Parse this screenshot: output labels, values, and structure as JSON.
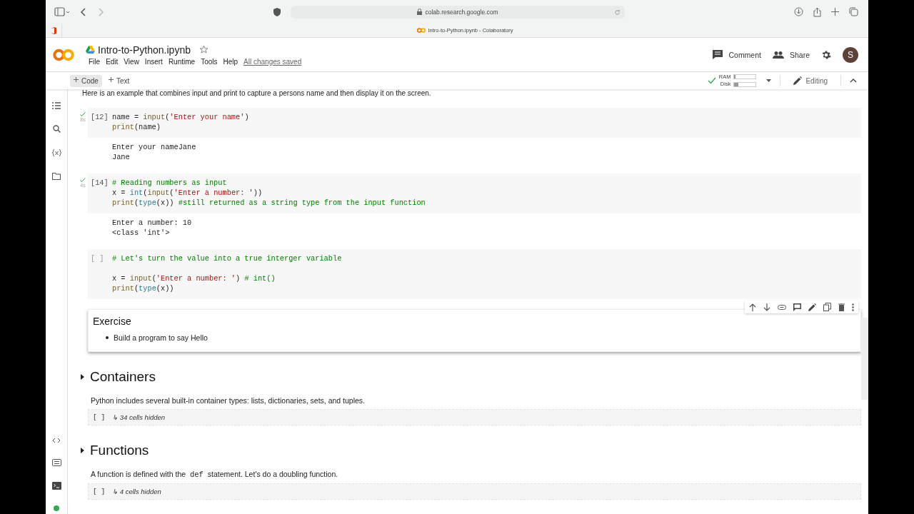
{
  "browser": {
    "url": "colab.research.google.com",
    "tab_title": "Intro-to-Python.ipynb - Colaboratory"
  },
  "header": {
    "notebook_title": "Intro-to-Python.ipynb",
    "starred": false,
    "menu": [
      "File",
      "Edit",
      "View",
      "Insert",
      "Runtime",
      "Tools",
      "Help"
    ],
    "save_status": "All changes saved",
    "comment": "Comment",
    "share": "Share",
    "avatar": "S"
  },
  "toolbar": {
    "add_code": "Code",
    "add_text": "Text",
    "ram_label": "RAM",
    "disk_label": "Disk",
    "ram": {
      "level": 0.05
    },
    "disk": {
      "level": 0.2
    },
    "connected": true,
    "mode": "Editing"
  },
  "cells": [
    {
      "kind": "text",
      "text": "Here is an example that combines input and print to capture a persons name and then display it on the screen."
    },
    {
      "kind": "code",
      "count": "[12]",
      "ran": true,
      "time": "8s",
      "lines": [
        {
          "kind": "code",
          "tokens": [
            {
              "text": "name = ",
              "kind": "plain"
            },
            {
              "text": "input",
              "kind": "builtin"
            },
            {
              "text": "(",
              "kind": "plain"
            },
            {
              "text": "'Enter your name'",
              "kind": "string"
            },
            {
              "text": ")",
              "kind": "plain"
            }
          ]
        },
        {
          "kind": "code",
          "tokens": [
            {
              "text": "print",
              "kind": "builtin"
            },
            {
              "text": "(name)",
              "kind": "plain"
            }
          ]
        }
      ],
      "output": [
        "Enter your nameJane",
        "Jane"
      ]
    },
    {
      "kind": "code",
      "count": "[14]",
      "ran": true,
      "time": "4s",
      "lines": [
        {
          "kind": "code",
          "tokens": [
            {
              "text": "# Reading numbers as input",
              "kind": "comment"
            }
          ]
        },
        {
          "kind": "code",
          "tokens": [
            {
              "text": "x = ",
              "kind": "plain"
            },
            {
              "text": "int",
              "kind": "type"
            },
            {
              "text": "(",
              "kind": "plain"
            },
            {
              "text": "input",
              "kind": "builtin"
            },
            {
              "text": "(",
              "kind": "plain"
            },
            {
              "text": "'Enter a number: '",
              "kind": "string"
            },
            {
              "text": "))",
              "kind": "plain"
            }
          ]
        },
        {
          "kind": "code",
          "tokens": [
            {
              "text": "print",
              "kind": "builtin"
            },
            {
              "text": "(",
              "kind": "plain"
            },
            {
              "text": "type",
              "kind": "type"
            },
            {
              "text": "(x)) ",
              "kind": "plain"
            },
            {
              "text": "#still returned as a string type from the input function",
              "kind": "comment"
            }
          ]
        }
      ],
      "output": [
        "Enter a number: 10",
        "<class 'int'>"
      ]
    },
    {
      "kind": "code",
      "count": "[ ]",
      "ran": false,
      "lines": [
        {
          "kind": "code",
          "tokens": [
            {
              "text": "# Let's turn the value into a true interger variable",
              "kind": "comment"
            }
          ]
        },
        {
          "kind": "blank"
        },
        {
          "kind": "code",
          "tokens": [
            {
              "text": "x = ",
              "kind": "plain"
            },
            {
              "text": "input",
              "kind": "builtin"
            },
            {
              "text": "(",
              "kind": "plain"
            },
            {
              "text": "'Enter a number: '",
              "kind": "string"
            },
            {
              "text": ") ",
              "kind": "plain"
            },
            {
              "text": "# int()",
              "kind": "comment"
            }
          ]
        },
        {
          "kind": "code",
          "tokens": [
            {
              "text": "print",
              "kind": "builtin"
            },
            {
              "text": "(",
              "kind": "plain"
            },
            {
              "text": "type",
              "kind": "type"
            },
            {
              "text": "(x))",
              "kind": "plain"
            }
          ]
        }
      ]
    },
    {
      "kind": "exercise",
      "selected": true,
      "title": "Exercise",
      "bullets": [
        "Build a program to say Hello"
      ]
    },
    {
      "kind": "section",
      "title": "Containers",
      "expanded": false,
      "text_parts": [
        {
          "text": "Python includes several built-in container types: lists, dictionaries, sets, and tuples.",
          "kind": "plain"
        }
      ],
      "hidden_count": "[ ]",
      "hidden": "↳ 34 cells hidden"
    },
    {
      "kind": "section",
      "title": "Functions",
      "expanded": false,
      "text_parts": [
        {
          "text": "A function is defined with the ",
          "kind": "plain"
        },
        {
          "text": "def",
          "kind": "code"
        },
        {
          "text": " statement. Let's do a doubling function.",
          "kind": "plain"
        }
      ],
      "hidden_count": "[ ]",
      "hidden": "↳ 4 cells hidden"
    }
  ]
}
